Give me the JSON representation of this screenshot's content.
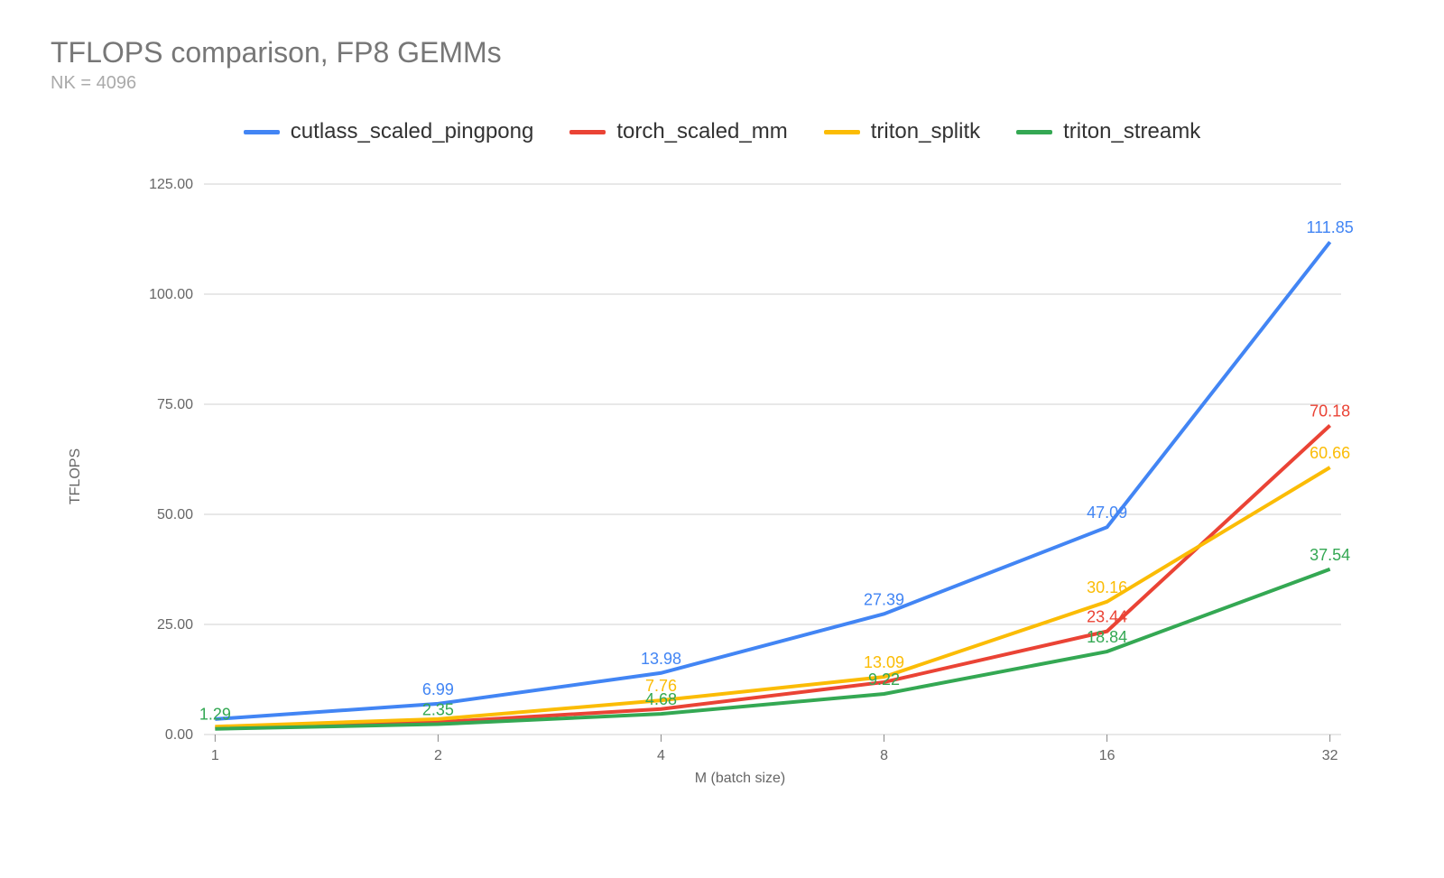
{
  "chart_data": {
    "type": "line",
    "title": "TFLOPS comparison, FP8 GEMMs",
    "subtitle": "NK = 4096",
    "xlabel": "M (batch size)",
    "ylabel": "TFLOPS",
    "ylim": [
      0,
      125
    ],
    "yticks": [
      0,
      25,
      50,
      75,
      100,
      125
    ],
    "ytick_labels": [
      "0.00",
      "25.00",
      "50.00",
      "75.00",
      "100.00",
      "125.00"
    ],
    "categories": [
      "1",
      "2",
      "4",
      "8",
      "16",
      "32"
    ],
    "series": [
      {
        "name": "cutlass_scaled_pingpong",
        "color": "#4285F4",
        "values": [
          3.5,
          6.99,
          13.98,
          27.39,
          47.09,
          111.85
        ]
      },
      {
        "name": "torch_scaled_mm",
        "color": "#EA4335",
        "values": [
          1.5,
          2.8,
          5.8,
          11.9,
          23.44,
          70.18
        ]
      },
      {
        "name": "triton_splitk",
        "color": "#FBBC05",
        "values": [
          1.8,
          3.5,
          7.76,
          13.09,
          30.16,
          60.66
        ]
      },
      {
        "name": "triton_streamk",
        "color": "#34A853",
        "values": [
          1.29,
          2.35,
          4.68,
          9.22,
          18.84,
          37.54
        ]
      }
    ],
    "visible_data_labels": {
      "cutlass_scaled_pingpong": {
        "2": "6.99",
        "4": "13.98",
        "8": "27.39",
        "16": "47.09",
        "32": "111.85"
      },
      "torch_scaled_mm": {
        "16": "23.44",
        "32": "70.18"
      },
      "triton_splitk": {
        "4": "7.76",
        "8": "13.09",
        "16": "30.16",
        "32": "60.66"
      },
      "triton_streamk": {
        "1": "1.29",
        "2": "2.35",
        "4": "4.68",
        "8": "9.22",
        "16": "18.84",
        "32": "37.54"
      }
    }
  }
}
